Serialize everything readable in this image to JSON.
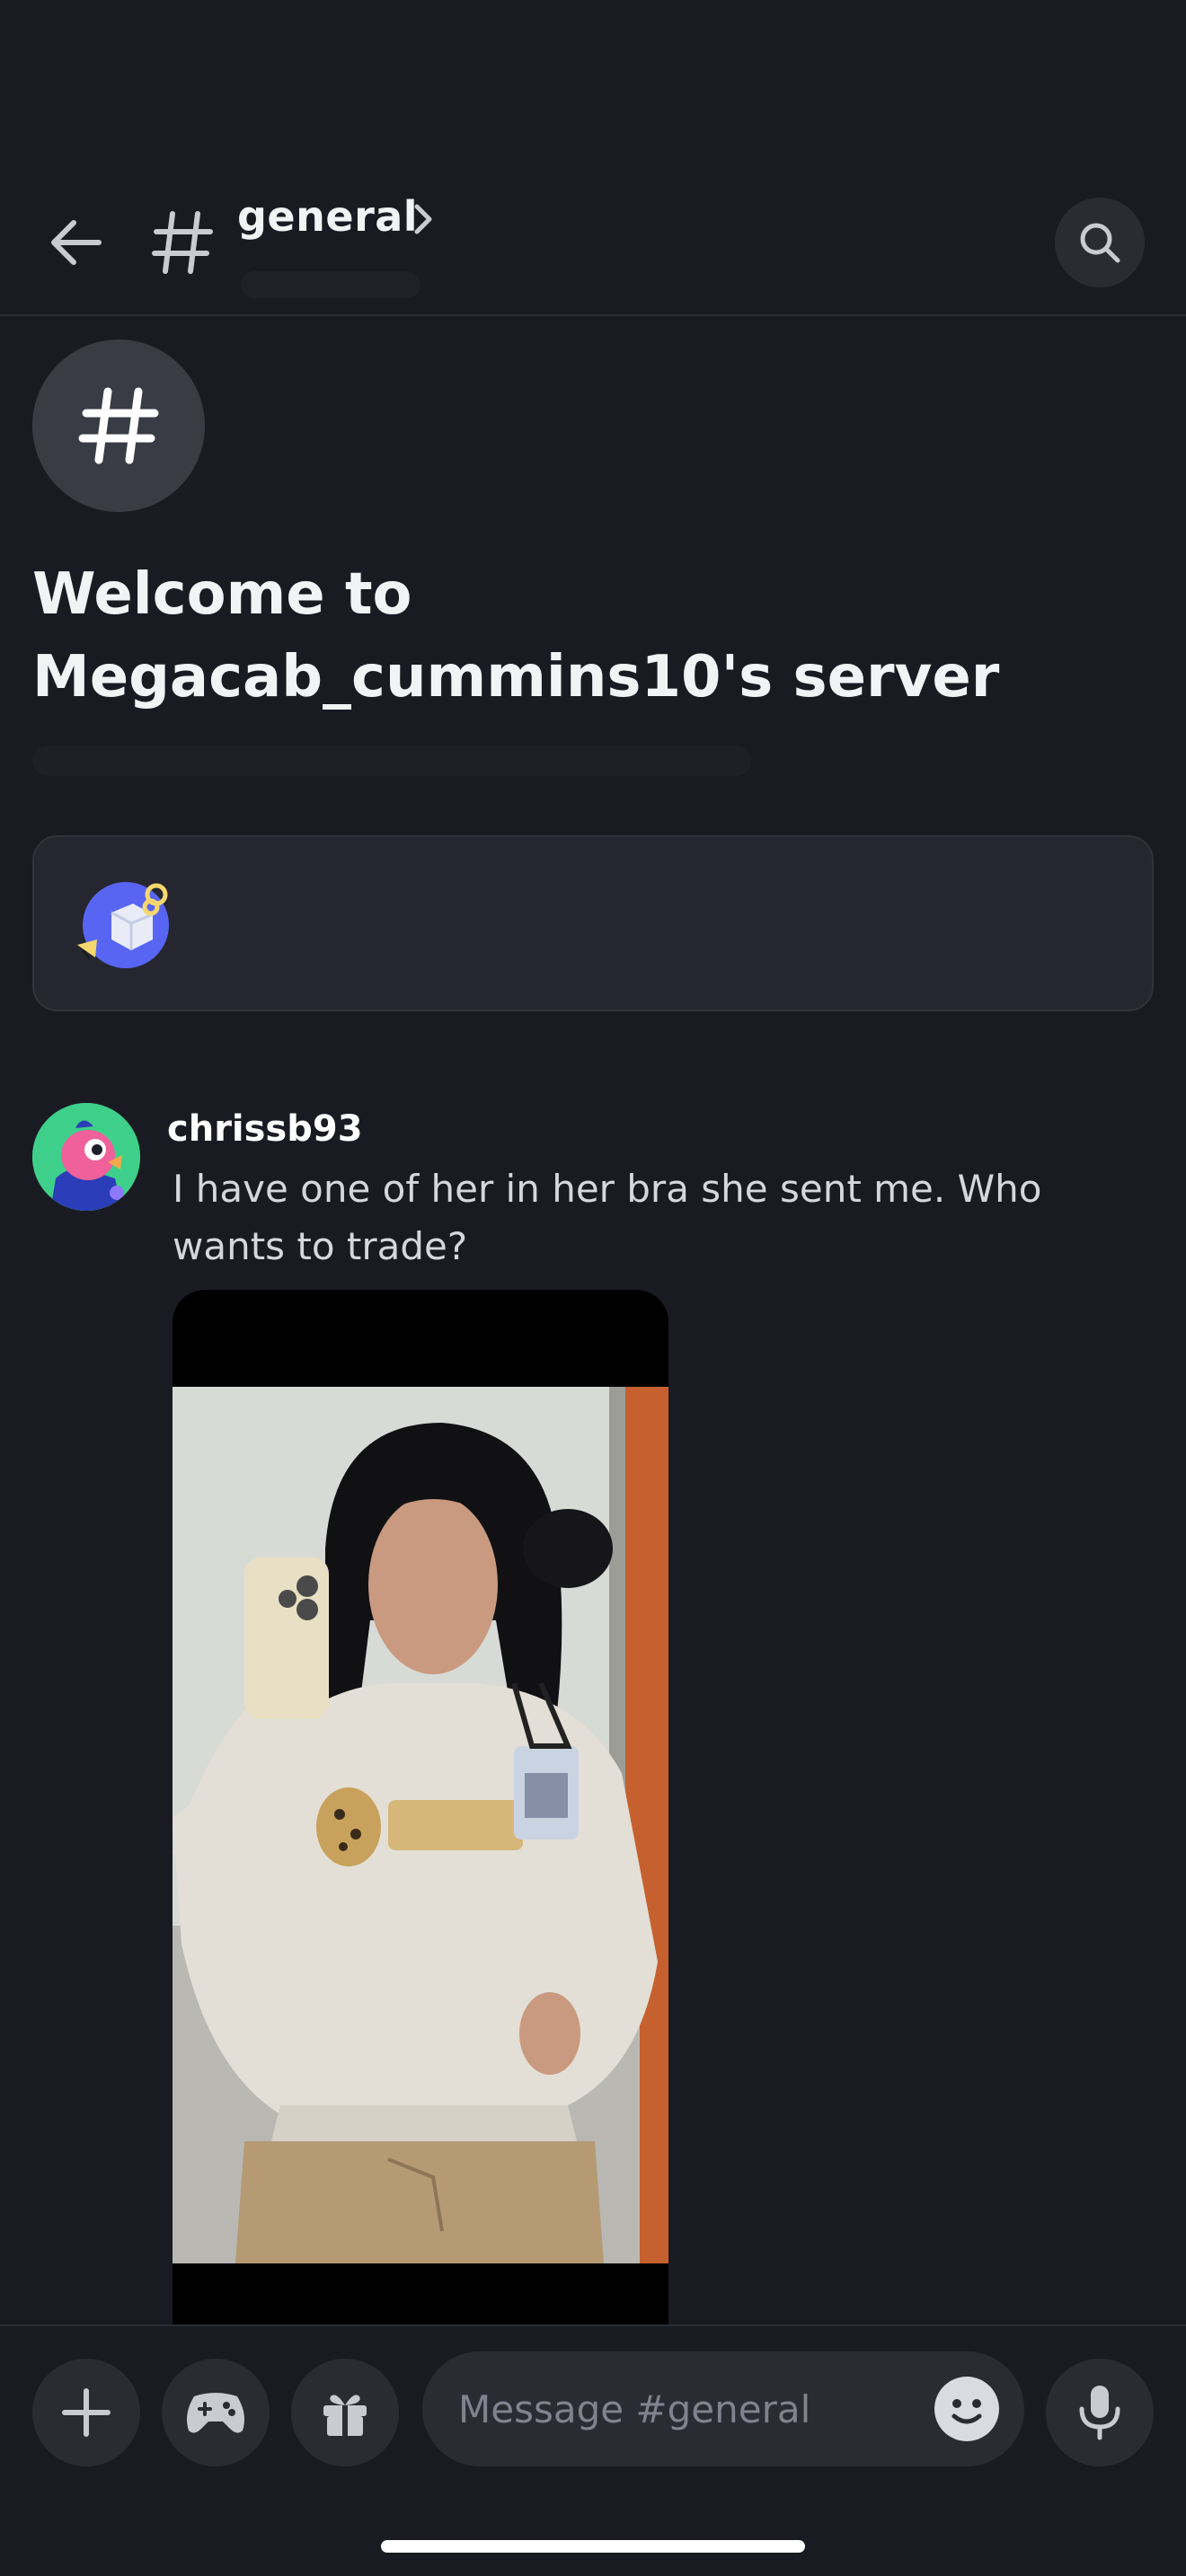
{
  "header": {
    "channel_name": "general",
    "icons": {
      "back": "arrow-left-icon",
      "channel": "hash-icon",
      "chevron": "chevron-right-icon",
      "search": "search-icon"
    }
  },
  "welcome": {
    "title": "Welcome to Megacab_cummins10's server",
    "icon": "hash-icon"
  },
  "card": {
    "icon": "key-cube-icon"
  },
  "message": {
    "username": "chrissb93",
    "text": "I have one of her in her bra she sent me. Who wants to trade?",
    "attachment": "image"
  },
  "composer": {
    "placeholder": "Message #general",
    "icons": {
      "add": "plus-icon",
      "activities": "gamepad-icon",
      "gift": "gift-icon",
      "emoji": "emoji-icon",
      "voice": "microphone-icon"
    }
  },
  "colors": {
    "background": "#1a1b22",
    "surface": "#2a2c34",
    "text": "#f2f3f5",
    "muted": "#80838f"
  }
}
